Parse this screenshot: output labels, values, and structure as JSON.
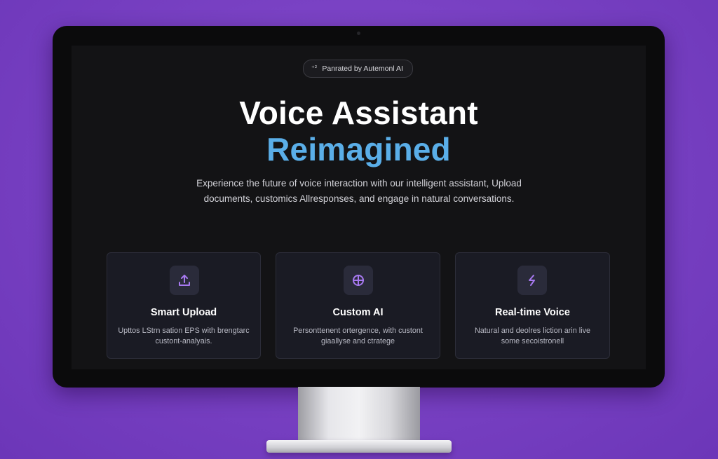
{
  "badge": {
    "icon": "sparkle-icon",
    "label": "Panrated by Autemonl AI"
  },
  "hero": {
    "title_line1": "Voice Assistant",
    "title_line2": "Reimagined",
    "subtitle": "Experience the future of voice interaction with our intelligent assistant, Upload documents, customics Allresponses, and engage in natural conversations."
  },
  "features": [
    {
      "icon": "upload-icon",
      "title": "Smart Upload",
      "description": "Upttos LStrn sation EPS with brengtarc custont-analyais."
    },
    {
      "icon": "crosshair-icon",
      "title": "Custom AI",
      "description": "Personttenent ortergence, with custont giaallyse and ctratege"
    },
    {
      "icon": "lightning-icon",
      "title": "Real-time Voice",
      "description": "Natural and deolres liction arin live some secoistronell"
    }
  ],
  "colors": {
    "background_purple": "#7a42c4",
    "screen_bg": "#131315",
    "accent_blue": "#5aaee8",
    "icon_purple": "#a779f0",
    "card_bg": "#1a1b24"
  }
}
